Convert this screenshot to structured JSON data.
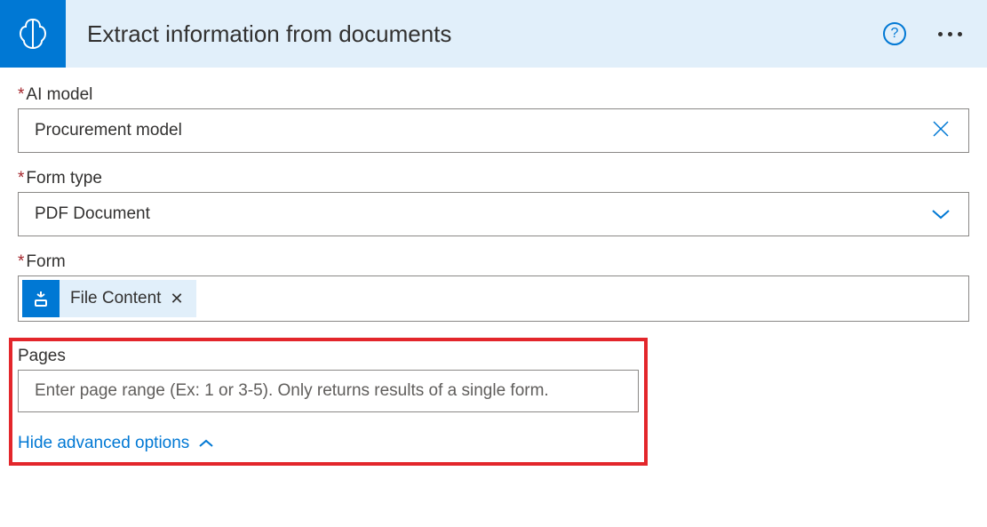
{
  "header": {
    "title": "Extract information from documents",
    "help_aria": "Help",
    "more_aria": "More options"
  },
  "fields": {
    "ai_model": {
      "label": "AI model",
      "required": true,
      "value": "Procurement model",
      "clear_aria": "Clear"
    },
    "form_type": {
      "label": "Form type",
      "required": true,
      "value": "PDF Document"
    },
    "form": {
      "label": "Form",
      "required": true,
      "token_label": "File Content",
      "token_remove_aria": "Remove"
    },
    "pages": {
      "label": "Pages",
      "placeholder": "Enter page range (Ex: 1 or 3-5). Only returns results of a single form."
    }
  },
  "toggle": {
    "label": "Hide advanced options"
  }
}
